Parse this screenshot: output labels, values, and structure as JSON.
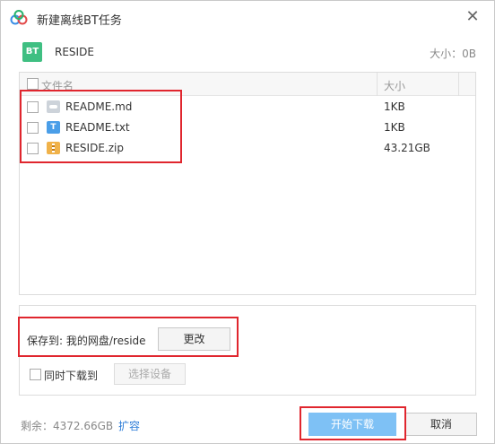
{
  "window": {
    "title": "新建离线BT任务"
  },
  "task": {
    "badge": "BT",
    "name": "RESIDE",
    "size_label": "大小：0B"
  },
  "file_list": {
    "columns": [
      "文件名",
      "大小"
    ],
    "files": [
      {
        "name": "README.md",
        "size": "1KB",
        "icon": "md-file-icon"
      },
      {
        "name": "README.txt",
        "size": "1KB",
        "icon": "txt-file-icon"
      },
      {
        "name": "RESIDE.zip",
        "size": "43.21GB",
        "icon": "zip-file-icon"
      }
    ]
  },
  "save": {
    "path_label": "保存到: 我的网盘/reside",
    "change_label": "更改"
  },
  "sync": {
    "label": "同时下载到",
    "device_button": "选择设备"
  },
  "footer": {
    "space_remaining": "剩余：4372.66GB",
    "expand_label": "扩容",
    "start_label": "开始下载",
    "cancel_label": "取消"
  },
  "colors": {
    "accent": "#7ec1f5",
    "link": "#2f7ed8",
    "highlight": "#e0262e",
    "bt_badge": "#3fbf82"
  },
  "icons": {
    "logo": "cloud-logo-icon",
    "close": "close-icon",
    "ficon_txt_glyph": "T"
  }
}
